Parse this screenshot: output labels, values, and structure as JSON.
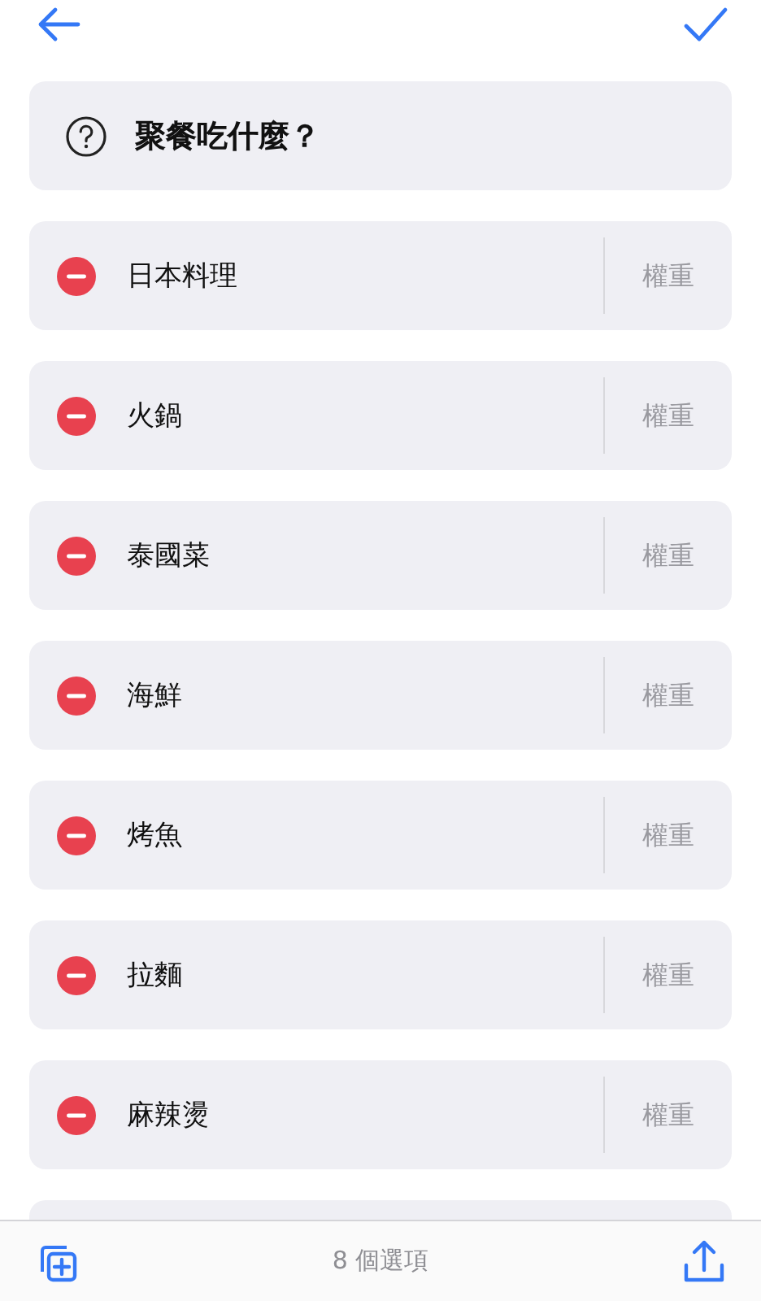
{
  "question": "聚餐吃什麼？",
  "options": [
    {
      "label": "日本料理",
      "weight_placeholder": "權重"
    },
    {
      "label": "火鍋",
      "weight_placeholder": "權重"
    },
    {
      "label": "泰國菜",
      "weight_placeholder": "權重"
    },
    {
      "label": "海鮮",
      "weight_placeholder": "權重"
    },
    {
      "label": "烤魚",
      "weight_placeholder": "權重"
    },
    {
      "label": "拉麵",
      "weight_placeholder": "權重"
    },
    {
      "label": "麻辣燙",
      "weight_placeholder": "權重"
    }
  ],
  "footer": {
    "count": "8 個選項"
  }
}
